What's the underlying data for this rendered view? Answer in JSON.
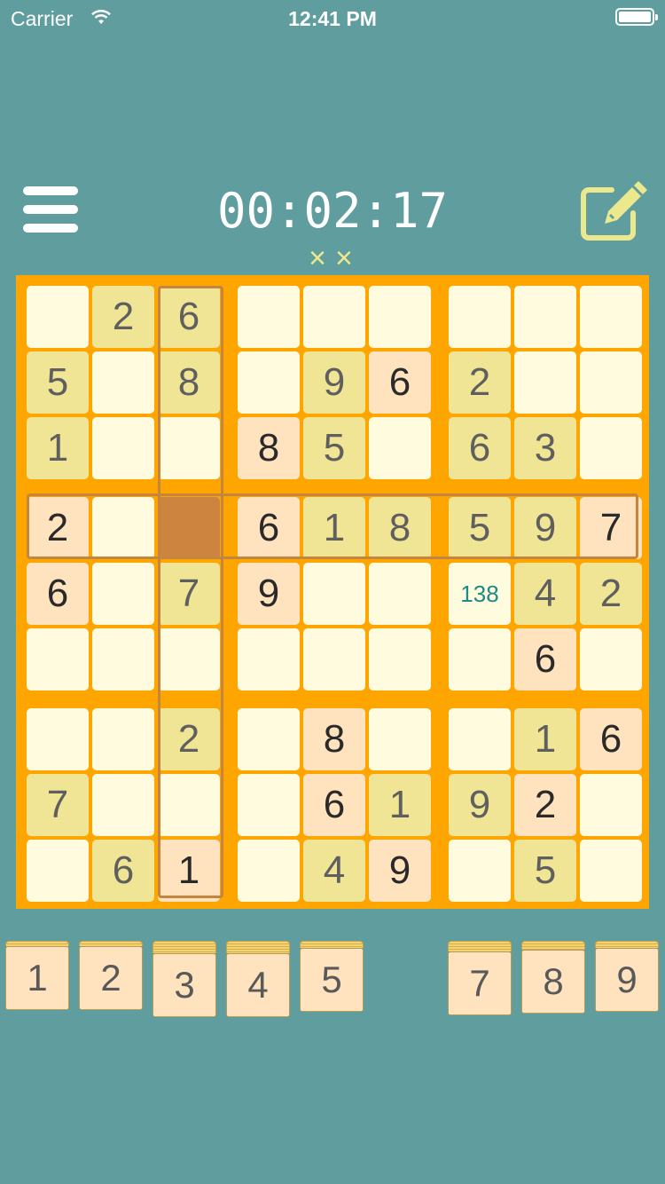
{
  "status_bar": {
    "carrier": "Carrier",
    "time": "12:41 PM"
  },
  "header": {
    "timer": "00:02:17",
    "mistakes": "××"
  },
  "board": {
    "rows": [
      [
        "",
        "2",
        "6",
        "",
        "",
        "",
        "",
        "",
        ""
      ],
      [
        "5",
        "",
        "8",
        "",
        "9",
        "6",
        "2",
        "",
        ""
      ],
      [
        "1",
        "",
        "",
        "8",
        "5",
        "",
        "6",
        "3",
        ""
      ],
      [
        "2",
        "",
        "",
        "6",
        "1",
        "8",
        "5",
        "9",
        "7"
      ],
      [
        "6",
        "",
        "7",
        "9",
        "",
        "",
        "138",
        "4",
        "2"
      ],
      [
        "",
        "",
        "",
        "",
        "",
        "",
        "",
        "6",
        ""
      ],
      [
        "",
        "",
        "2",
        "",
        "8",
        "",
        "",
        "1",
        "6"
      ],
      [
        "7",
        "",
        "",
        "",
        "6",
        "1",
        "9",
        "2",
        ""
      ],
      [
        "",
        "6",
        "1",
        "",
        "4",
        "9",
        "",
        "5",
        ""
      ]
    ],
    "styles": [
      [
        "e",
        "a",
        "a",
        "e",
        "e",
        "e",
        "e",
        "e",
        "e"
      ],
      [
        "a",
        "e",
        "a",
        "e",
        "a",
        "b",
        "a",
        "e",
        "e"
      ],
      [
        "a",
        "e",
        "e",
        "b",
        "a",
        "e",
        "a",
        "a",
        "e"
      ],
      [
        "b",
        "e",
        "s",
        "b",
        "a",
        "a",
        "a",
        "a",
        "b"
      ],
      [
        "b",
        "e",
        "a",
        "b",
        "e",
        "e",
        "n",
        "a",
        "a"
      ],
      [
        "e",
        "e",
        "e",
        "e",
        "e",
        "e",
        "e",
        "b",
        "e"
      ],
      [
        "e",
        "e",
        "a",
        "e",
        "b",
        "e",
        "e",
        "a",
        "b"
      ],
      [
        "a",
        "e",
        "e",
        "e",
        "b",
        "a",
        "a",
        "b",
        "e"
      ],
      [
        "e",
        "a",
        "b",
        "e",
        "a",
        "b",
        "e",
        "a",
        "e"
      ]
    ],
    "selected_cell": {
      "row": 4,
      "col": 3
    },
    "colors": {
      "board": "#ffa500",
      "cell": "#fffbdf",
      "given_a": "#efe595",
      "given_b": "#ffe3be",
      "selected": "#cd843f",
      "note": "#1f8a87"
    }
  },
  "numpad": {
    "keys": [
      "1",
      "2",
      "3",
      "4",
      "5",
      "7",
      "8",
      "9"
    ]
  },
  "icons": {
    "menu": "hamburger-menu-icon",
    "edit": "pencil-note-icon"
  }
}
